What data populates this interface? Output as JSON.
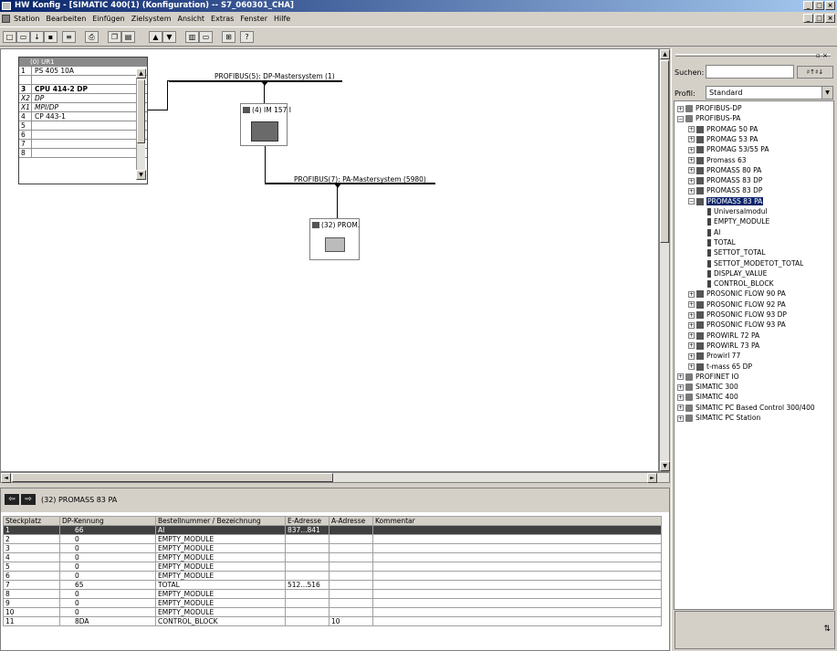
{
  "window": {
    "title": "HW Konfig - [SIMATIC 400(1) (Konfiguration) -- S7_060301_CHA]"
  },
  "menu": [
    "Station",
    "Bearbeiten",
    "Einfügen",
    "Zielsystem",
    "Ansicht",
    "Extras",
    "Fenster",
    "Hilfe"
  ],
  "rack": {
    "title": "(0) UR1",
    "rows": [
      {
        "slot": "1",
        "name": "PS 405 10A",
        "style": ""
      },
      {
        "slot": "",
        "name": "",
        "style": ""
      },
      {
        "slot": "3",
        "name": "CPU 414-2 DP",
        "style": "bold"
      },
      {
        "slot": "X2",
        "name": "DP",
        "style": "it"
      },
      {
        "slot": "X1",
        "name": "MPI/DP",
        "style": "it"
      },
      {
        "slot": "4",
        "name": "CP 443-1",
        "style": ""
      },
      {
        "slot": "5",
        "name": "",
        "style": ""
      },
      {
        "slot": "6",
        "name": "",
        "style": ""
      },
      {
        "slot": "7",
        "name": "",
        "style": ""
      },
      {
        "slot": "8",
        "name": "",
        "style": ""
      }
    ]
  },
  "canvas": {
    "dp_bus": "PROFIBUS(5): DP-Mastersystem (1)",
    "pa_bus": "PROFIBUS(7): PA-Mastersystem (5980)",
    "im_label": "(4) IM 157 I",
    "prom_label": "(32) PROM."
  },
  "catalog": {
    "search_label": "Suchen:",
    "search_value": "",
    "profile_label": "Profil:",
    "profile_value": "Standard",
    "tree": [
      {
        "label": "PROFIBUS-DP",
        "level": 0,
        "exp": "+",
        "icon": "net"
      },
      {
        "label": "PROFIBUS-PA",
        "level": 0,
        "exp": "-",
        "icon": "net"
      },
      {
        "label": "PROMAG 50 PA",
        "level": 1,
        "exp": "+",
        "icon": "dev"
      },
      {
        "label": "PROMAG 53 PA",
        "level": 1,
        "exp": "+",
        "icon": "dev"
      },
      {
        "label": "PROMAG 53/55 PA",
        "level": 1,
        "exp": "+",
        "icon": "dev"
      },
      {
        "label": "Promass 63",
        "level": 1,
        "exp": "+",
        "icon": "dev"
      },
      {
        "label": "PROMASS 80 PA",
        "level": 1,
        "exp": "+",
        "icon": "dev"
      },
      {
        "label": "PROMASS 83 DP",
        "level": 1,
        "exp": "+",
        "icon": "dev"
      },
      {
        "label": "PROMASS 83 DP",
        "level": 1,
        "exp": "+",
        "icon": "dev"
      },
      {
        "label": "PROMASS 83 PA",
        "level": 1,
        "exp": "-",
        "icon": "dev",
        "sel": true
      },
      {
        "label": "Universalmodul",
        "level": 2,
        "exp": "",
        "icon": "mod"
      },
      {
        "label": "EMPTY_MODULE",
        "level": 2,
        "exp": "",
        "icon": "mod"
      },
      {
        "label": "AI",
        "level": 2,
        "exp": "",
        "icon": "mod"
      },
      {
        "label": "TOTAL",
        "level": 2,
        "exp": "",
        "icon": "mod"
      },
      {
        "label": "SETTOT_TOTAL",
        "level": 2,
        "exp": "",
        "icon": "mod"
      },
      {
        "label": "SETTOT_MODETOT_TOTAL",
        "level": 2,
        "exp": "",
        "icon": "mod"
      },
      {
        "label": "DISPLAY_VALUE",
        "level": 2,
        "exp": "",
        "icon": "mod"
      },
      {
        "label": "CONTROL_BLOCK",
        "level": 2,
        "exp": "",
        "icon": "mod"
      },
      {
        "label": "PROSONIC FLOW 90 PA",
        "level": 1,
        "exp": "+",
        "icon": "dev"
      },
      {
        "label": "PROSONIC FLOW 92 PA",
        "level": 1,
        "exp": "+",
        "icon": "dev"
      },
      {
        "label": "PROSONIC FLOW 93 DP",
        "level": 1,
        "exp": "+",
        "icon": "dev"
      },
      {
        "label": "PROSONIC FLOW 93 PA",
        "level": 1,
        "exp": "+",
        "icon": "dev"
      },
      {
        "label": "PROWIRL 72 PA",
        "level": 1,
        "exp": "+",
        "icon": "dev"
      },
      {
        "label": "PROWIRL 73 PA",
        "level": 1,
        "exp": "+",
        "icon": "dev"
      },
      {
        "label": "Prowirl 77",
        "level": 1,
        "exp": "+",
        "icon": "dev"
      },
      {
        "label": "t-mass 65 DP",
        "level": 1,
        "exp": "+",
        "icon": "dev"
      },
      {
        "label": "PROFINET IO",
        "level": 0,
        "exp": "+",
        "icon": "net"
      },
      {
        "label": "SIMATIC 300",
        "level": 0,
        "exp": "+",
        "icon": "net"
      },
      {
        "label": "SIMATIC 400",
        "level": 0,
        "exp": "+",
        "icon": "net"
      },
      {
        "label": "SIMATIC PC Based Control 300/400",
        "level": 0,
        "exp": "+",
        "icon": "net"
      },
      {
        "label": "SIMATIC PC Station",
        "level": 0,
        "exp": "+",
        "icon": "net"
      }
    ]
  },
  "detail": {
    "header": "(32)   PROMASS 83 PA",
    "columns": [
      "Steckplatz",
      "DP-Kennung",
      "Bestellnummer / Bezeichnung",
      "E-Adresse",
      "A-Adresse",
      "Kommentar"
    ],
    "rows": [
      [
        "1",
        "66",
        "AI",
        "837...841",
        "",
        ""
      ],
      [
        "2",
        "0",
        "EMPTY_MODULE",
        "",
        "",
        ""
      ],
      [
        "3",
        "0",
        "EMPTY_MODULE",
        "",
        "",
        ""
      ],
      [
        "4",
        "0",
        "EMPTY_MODULE",
        "",
        "",
        ""
      ],
      [
        "5",
        "0",
        "EMPTY_MODULE",
        "",
        "",
        ""
      ],
      [
        "6",
        "0",
        "EMPTY_MODULE",
        "",
        "",
        ""
      ],
      [
        "7",
        "65",
        "TOTAL",
        "512...516",
        "",
        ""
      ],
      [
        "8",
        "0",
        "EMPTY_MODULE",
        "",
        "",
        ""
      ],
      [
        "9",
        "0",
        "EMPTY_MODULE",
        "",
        "",
        ""
      ],
      [
        "10",
        "0",
        "EMPTY_MODULE",
        "",
        "",
        ""
      ],
      [
        "11",
        "8DA",
        "CONTROL_BLOCK",
        "",
        "10",
        ""
      ]
    ]
  }
}
